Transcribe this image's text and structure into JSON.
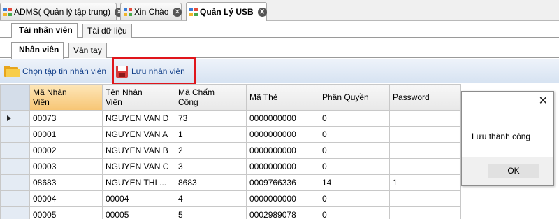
{
  "doc_tabs": [
    {
      "label": "ADMS( Quản lý tập trung)",
      "close": "✕"
    },
    {
      "label": "Xin Chào",
      "close": "✕"
    },
    {
      "label": "Quản Lý USB",
      "close": "✕"
    }
  ],
  "section_tabs": [
    "Tài nhân viên",
    "Tài dữ liệu"
  ],
  "sub_tabs": [
    "Nhân viên",
    "Vân tay"
  ],
  "toolbar": {
    "choose_file_label": "Chọn tập tin nhân viên",
    "save_label": "Lưu nhân viên"
  },
  "grid": {
    "columns": [
      {
        "line1": "Mã Nhân",
        "line2": "Viên"
      },
      {
        "line1": "Tên Nhân",
        "line2": "Viên"
      },
      {
        "line1": "Mã Chấm",
        "line2": "Công"
      },
      {
        "line1": "Mã Thẻ",
        "line2": ""
      },
      {
        "line1": "Phân Quyền",
        "line2": ""
      },
      {
        "line1": "Password",
        "line2": ""
      }
    ],
    "rows": [
      [
        "00073",
        "NGUYEN VAN D",
        "73",
        "0000000000",
        "0",
        ""
      ],
      [
        "00001",
        "NGUYEN VAN A",
        "1",
        "0000000000",
        "0",
        ""
      ],
      [
        "00002",
        "NGUYEN VAN B",
        "2",
        "0000000000",
        "0",
        ""
      ],
      [
        "00003",
        "NGUYEN VAN C",
        "3",
        "0000000000",
        "0",
        ""
      ],
      [
        "08683",
        "NGUYEN THI ...",
        "8683",
        "0009766336",
        "14",
        "1"
      ],
      [
        "00004",
        "00004",
        "4",
        "0000000000",
        "0",
        ""
      ],
      [
        "00005",
        "00005",
        "5",
        "0002989078",
        "0",
        ""
      ]
    ]
  },
  "message_box": {
    "text": "Lưu thành công",
    "close": "✕",
    "ok_label": "OK"
  },
  "colors": {
    "highlight": "#e0151b",
    "sorted_header": "#f7c574",
    "toolbar_text": "#15428b"
  }
}
